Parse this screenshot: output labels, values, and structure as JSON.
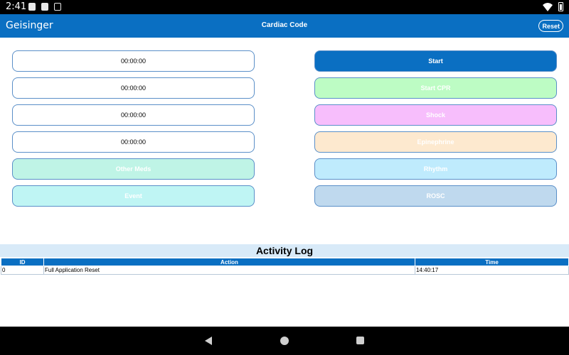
{
  "status_bar": {
    "time": "2:41"
  },
  "app_bar": {
    "brand": "Geisinger",
    "title": "Cardiac Code",
    "reset_label": "Reset"
  },
  "timers": [
    "00:00:00",
    "00:00:00",
    "00:00:00",
    "00:00:00"
  ],
  "left_buttons": {
    "other_meds": "Other Meds",
    "event": "Event"
  },
  "right_buttons": {
    "start": "Start",
    "start_cpr": "Start CPR",
    "shock": "Shock",
    "epinephrine": "Epinephrine",
    "rhythm": "Rhythm",
    "rosc": "ROSC"
  },
  "activity_log": {
    "title": "Activity Log",
    "columns": [
      "ID",
      "Action",
      "Time"
    ],
    "rows": [
      {
        "id": "0",
        "action": "Full Application Reset",
        "time": "14:40:17"
      }
    ]
  },
  "colors": {
    "app_bar": "#0a6fc2",
    "start": "#0a6fc2",
    "start_cpr": "#bdfcc4",
    "shock": "#f7befc",
    "epinephrine": "#fde9cf",
    "rhythm": "#bfebfd",
    "rosc": "#bfd9ee",
    "other_meds": "#bff4e6",
    "event": "#bff5f4"
  }
}
